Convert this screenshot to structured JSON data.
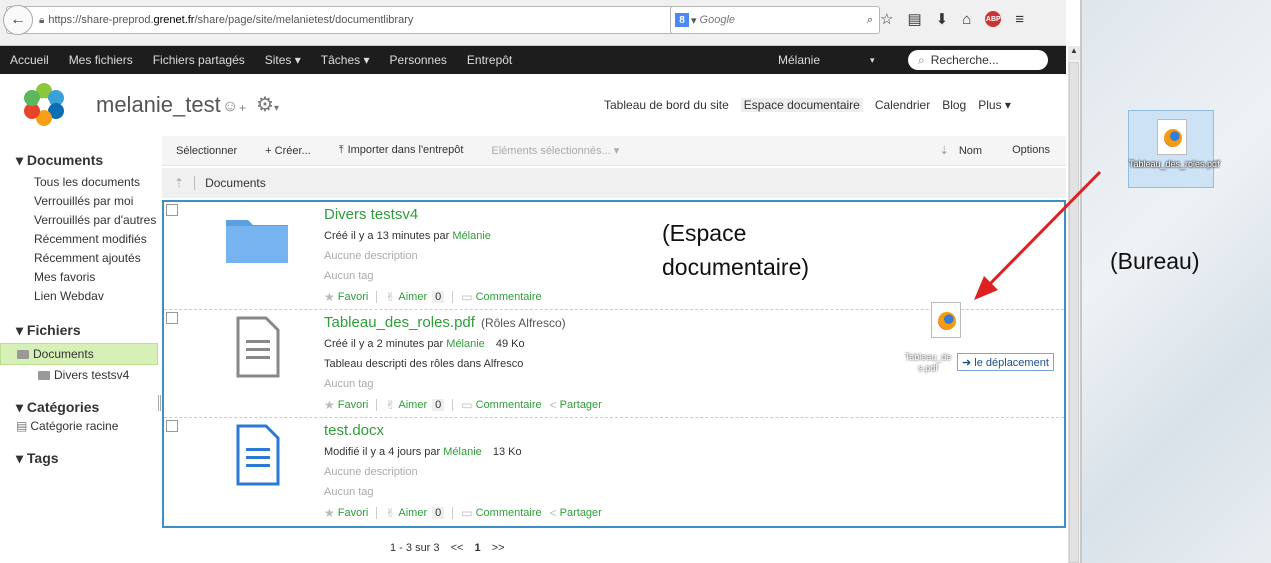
{
  "browser": {
    "url_prefix": "https://share-preprod.",
    "url_domain": "grenet.fr",
    "url_suffix": "/share/page/site/melanietest/documentlibrary",
    "search_placeholder": "Google",
    "search_engine_icon": "google-icon"
  },
  "topnav": {
    "items": [
      "Accueil",
      "Mes fichiers",
      "Fichiers partagés",
      "Sites ▾",
      "Tâches ▾",
      "Personnes",
      "Entrepôt"
    ],
    "user": "Mélanie",
    "search_label": "Recherche..."
  },
  "site": {
    "title": "melanie_test",
    "nav": [
      "Tableau de bord du site",
      "Espace documentaire",
      "Calendrier",
      "Blog",
      "Plus ▾"
    ],
    "active_nav": "Espace documentaire"
  },
  "sidebar": {
    "documents_heading": "▾ Documents",
    "document_links": [
      "Tous les documents",
      "Verrouillés par moi",
      "Verrouillés par d'autres",
      "Récemment modifiés",
      "Récemment ajoutés",
      "Mes favoris",
      "Lien Webdav"
    ],
    "files_heading": "▾ Fichiers",
    "tree_root": "Documents",
    "tree_child": "Divers testsv4",
    "categories_heading": "▾ Catégories",
    "category_root": "Catégorie racine",
    "tags_heading": "▾ Tags"
  },
  "toolbar": {
    "select": "Sélectionner",
    "create": "+ Créer...",
    "upload": "Importer dans l'entrepôt",
    "selected_items": "Eléments sélectionnés... ▾",
    "sort": "Nom",
    "options": "Options",
    "breadcrumb": "Documents"
  },
  "documents": [
    {
      "name": "Divers testsv4",
      "subtitle": "",
      "created_prefix": "Créé il y a 13 minutes par",
      "author": "Mélanie",
      "size": "",
      "description": "Aucune description",
      "tag": "Aucun tag",
      "favorite": "Favori",
      "like": "Aimer",
      "like_count": "0",
      "comment": "Commentaire",
      "share": ""
    },
    {
      "name": "Tableau_des_roles.pdf",
      "subtitle": "(Rôles Alfresco)",
      "created_prefix": "Créé il y a 2 minutes par",
      "author": "Mélanie",
      "size": "49 Ko",
      "description": "Tableau descripti des rôles dans Alfresco",
      "tag": "Aucun tag",
      "favorite": "Favori",
      "like": "Aimer",
      "like_count": "0",
      "comment": "Commentaire",
      "share": "Partager"
    },
    {
      "name": "test.docx",
      "subtitle": "",
      "created_prefix": "Modifié il y a 4 jours par",
      "author": "Mélanie",
      "size": "13 Ko",
      "description": "Aucune description",
      "tag": "Aucun tag",
      "favorite": "Favori",
      "like": "Aimer",
      "like_count": "0",
      "comment": "Commentaire",
      "share": "Partager"
    }
  ],
  "pager": {
    "range": "1 - 3 sur 3",
    "prev": "<<",
    "current": "1",
    "next": ">>"
  },
  "annotations": {
    "espace_line1": "(Espace",
    "espace_line2": "documentaire)",
    "bureau": "(Bureau)"
  },
  "desktop": {
    "file_label": "Tableau_des_roles.pdf"
  },
  "drag": {
    "label": "Tableau_de s.pdf",
    "tooltip": "➜ le déplacement"
  },
  "colors": {
    "accent_green": "#2e9e3a",
    "selection_blue": "#3c8fc7",
    "arrow_red": "#e02020"
  }
}
